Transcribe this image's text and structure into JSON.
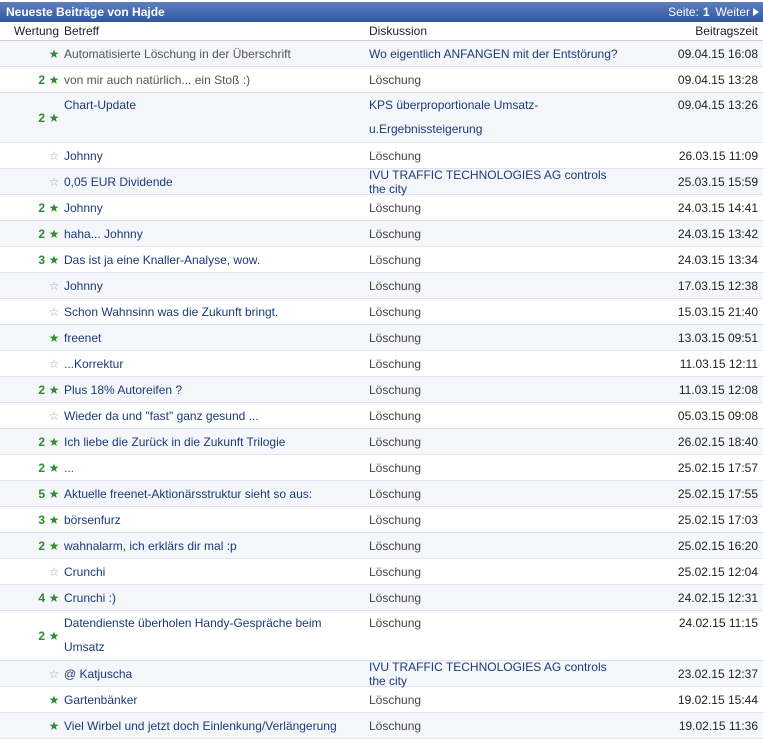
{
  "header": {
    "title": "Neueste Beiträge von Hajde",
    "page_label": "Seite:",
    "page_number": "1",
    "next_label": "Weiter"
  },
  "columns": {
    "rating": "Wertung",
    "subject": "Betreff",
    "discussion": "Diskussion",
    "time": "Beitragszeit"
  },
  "rows": [
    {
      "count": "",
      "star": "filled",
      "subject": "Automatisierte Löschung in der Überschrift",
      "discussion": "Wo eigentlich ANFANGEN mit der Entstörung?",
      "time": "09.04.15 16:08",
      "grey": true
    },
    {
      "count": "2",
      "star": "filled",
      "subject": "von mir auch natürlich... ein Stoß :)",
      "discussion": "Löschung",
      "time": "09.04.15 13:28",
      "grey": true
    },
    {
      "count": "2",
      "star": "filled",
      "subject": "Chart-Update",
      "discussion": "KPS überproportionale Umsatz-u.Ergebnissteigerung",
      "time": "09.04.15 13:26",
      "tall": true
    },
    {
      "count": "",
      "star": "empty",
      "subject": "Johnny",
      "discussion": "Löschung",
      "time": "26.03.15 11:09"
    },
    {
      "count": "",
      "star": "empty",
      "subject": "0,05 EUR Dividende",
      "discussion": "IVU TRAFFIC TECHNOLOGIES AG controls the city",
      "time": "25.03.15 15:59"
    },
    {
      "count": "2",
      "star": "filled",
      "subject": "Johnny",
      "discussion": "Löschung",
      "time": "24.03.15 14:41"
    },
    {
      "count": "2",
      "star": "filled",
      "subject": "haha... Johnny",
      "discussion": "Löschung",
      "time": "24.03.15 13:42"
    },
    {
      "count": "3",
      "star": "filled",
      "subject": "Das ist ja eine Knaller-Analyse, wow.",
      "discussion": "Löschung",
      "time": "24.03.15 13:34"
    },
    {
      "count": "",
      "star": "empty",
      "subject": "Johnny",
      "discussion": "Löschung",
      "time": "17.03.15 12:38"
    },
    {
      "count": "",
      "star": "empty",
      "subject": "Schon Wahnsinn was die Zukunft bringt.",
      "discussion": "Löschung",
      "time": "15.03.15 21:40"
    },
    {
      "count": "",
      "star": "filled",
      "subject": "freenet",
      "discussion": "Löschung",
      "time": "13.03.15 09:51"
    },
    {
      "count": "",
      "star": "empty",
      "subject": "...Korrektur",
      "discussion": "Löschung",
      "time": "11.03.15 12:11"
    },
    {
      "count": "2",
      "star": "filled",
      "subject": "Plus 18% Autoreifen ?",
      "discussion": "Löschung",
      "time": "11.03.15 12:08"
    },
    {
      "count": "",
      "star": "empty",
      "subject": "Wieder da und \"fast\" ganz gesund ...",
      "discussion": "Löschung",
      "time": "05.03.15 09:08"
    },
    {
      "count": "2",
      "star": "filled",
      "subject": "Ich liebe die Zurück in die Zukunft Trilogie",
      "discussion": "Löschung",
      "time": "26.02.15 18:40"
    },
    {
      "count": "2",
      "star": "filled",
      "subject": "...",
      "discussion": "Löschung",
      "time": "25.02.15 17:57"
    },
    {
      "count": "5",
      "star": "filled",
      "subject": "Aktuelle freenet-Aktionärsstruktur sieht so aus:",
      "discussion": "Löschung",
      "time": "25.02.15 17:55"
    },
    {
      "count": "3",
      "star": "filled",
      "subject": "börsenfurz",
      "discussion": "Löschung",
      "time": "25.02.15 17:03"
    },
    {
      "count": "2",
      "star": "filled",
      "subject": "wahnalarm, ich erklärs dir mal :p",
      "discussion": "Löschung",
      "time": "25.02.15 16:20"
    },
    {
      "count": "",
      "star": "empty",
      "subject": "Crunchi",
      "discussion": "Löschung",
      "time": "25.02.15 12:04"
    },
    {
      "count": "4",
      "star": "filled",
      "subject": "Crunchi :)",
      "discussion": "Löschung",
      "time": "24.02.15 12:31"
    },
    {
      "count": "2",
      "star": "filled",
      "subject": "Datendienste überholen Handy-Gespräche beim Umsatz",
      "discussion": "Löschung",
      "time": "24.02.15 11:15",
      "tall": true
    },
    {
      "count": "",
      "star": "empty",
      "subject": "@ Katjuscha",
      "discussion": "IVU TRAFFIC TECHNOLOGIES AG controls the city",
      "time": "23.02.15 12:37"
    },
    {
      "count": "",
      "star": "filled",
      "subject": "Gartenbänker",
      "discussion": "Löschung",
      "time": "19.02.15 15:44"
    },
    {
      "count": "",
      "star": "filled",
      "subject": "Viel Wirbel und jetzt doch Einlenkung/Verlängerung",
      "discussion": "Löschung",
      "time": "19.02.15 11:36"
    }
  ],
  "colors": {
    "bar": "#2f56a0",
    "link": "#1a3a7a",
    "star": "#2e8b2e",
    "star_empty": "#9aa5b8"
  }
}
